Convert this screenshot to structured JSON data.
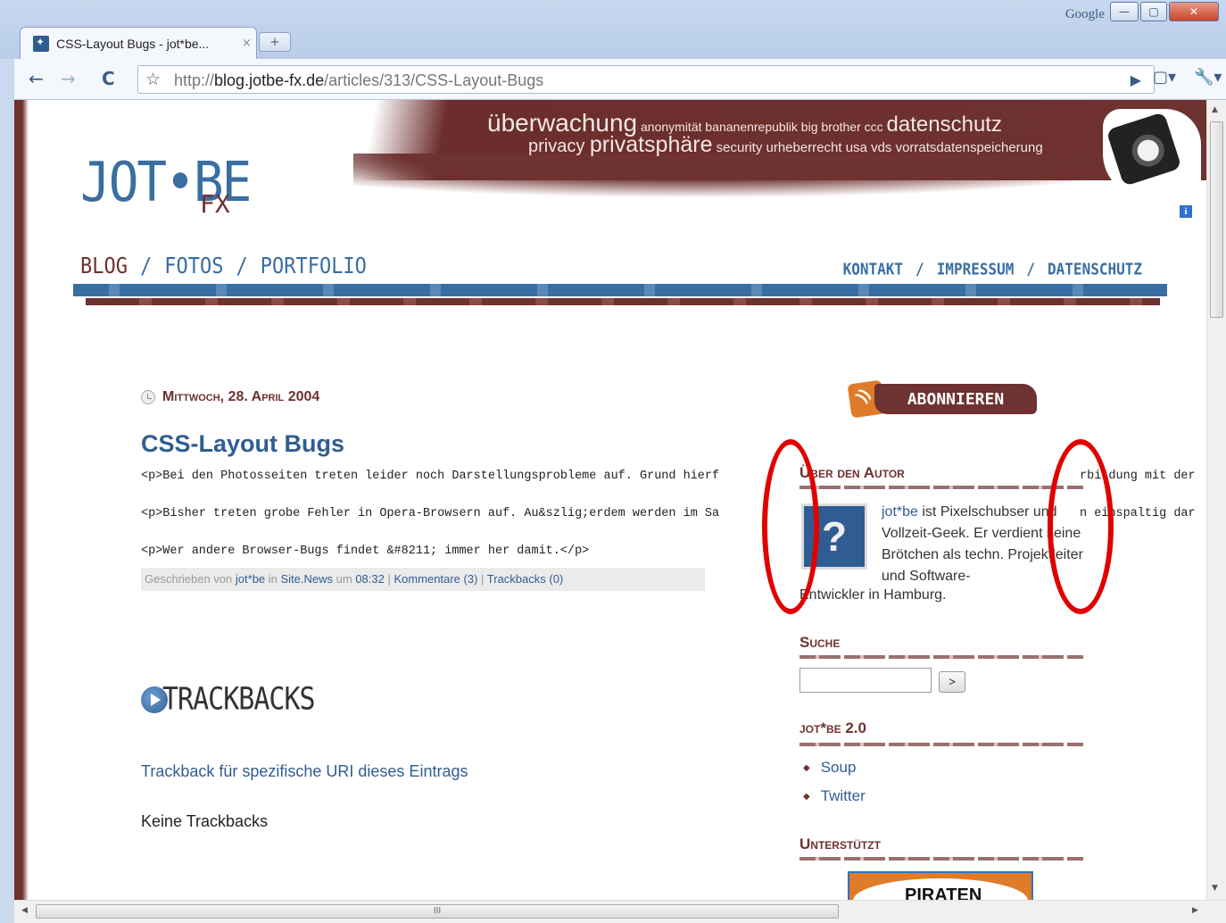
{
  "window": {
    "brand_label": "Google",
    "min_label": "—",
    "max_label": "▢",
    "close_label": "✕"
  },
  "tab": {
    "title": "CSS-Layout Bugs - jot*be...",
    "close": "×",
    "new_tab": "+"
  },
  "toolbar": {
    "back": "←",
    "forward": "→",
    "reload": "C",
    "star": "☆",
    "url_prefix": "http://",
    "url_domain": "blog.jotbe-fx.de",
    "url_path": "/articles/313/CSS-Layout-Bugs",
    "go": "▶",
    "page_menu": "▢▾",
    "wrench_menu": "🔧▾"
  },
  "header": {
    "tags_line1": {
      "w1": "überwachung",
      "w2": " anonymität bananenrepublik big brother ccc ",
      "w3": "datenschutz"
    },
    "tags_line2": {
      "w1": "privacy ",
      "w2": "privatsphäre",
      "w3": " security urheberrecht usa vds vorratsdatenspeicherung"
    },
    "logo": "JOT•BE",
    "logo_sub": "FX",
    "info": "i",
    "nav_left": [
      "BLOG",
      "FOTOS",
      "PORTFOLIO"
    ],
    "nav_right": [
      "KONTAKT",
      "IMPRESSUM",
      "DATENSCHUTZ"
    ],
    "separator": "/"
  },
  "post": {
    "date": "Mittwoch, 28. April 2004",
    "title": "CSS-Layout Bugs",
    "lines": [
      "<p>Bei den Photosseiten treten leider noch Darstellungsprobleme auf. Grund hierf",
      "<p>Bisher treten grobe Fehler in Opera-Browsern auf. Au&szlig;erdem werden im Sa",
      "<p>Wer andere Browser-Bugs findet &#8211; immer her damit.</p>"
    ],
    "line_tails": [
      "rbi dung mit der",
      "n einspaltig dar"
    ],
    "meta": {
      "written_by": "Geschrieben von ",
      "author": "jot*be",
      "in": " in ",
      "category": "Site.News",
      "at": " um ",
      "time": "08:32",
      "sep": " | ",
      "comments": "Kommentare (3)",
      "trackbacks": "Trackbacks (0)"
    }
  },
  "trackbacks": {
    "heading": "TRACKBACKS",
    "link": "Trackback für spezifische URI dieses Eintrags",
    "none": "Keine Trackbacks"
  },
  "sidebar": {
    "subscribe": "ABONNIEREN",
    "about_title": "Über den Autor",
    "avatar_glyph": "?",
    "about_link": "jot*be",
    "about_text": " ist Pixelschubser und Vollzeit-Geek. Er verdient seine Brötchen als techn. Projektleiter und Software-",
    "about_text2": "Entwickler in Hamburg.",
    "search_title": "Suche",
    "search_button": ">",
    "jotbe_title": "jot*be 2.0",
    "links": [
      "Soup",
      "Twitter"
    ],
    "support_title": "Unterstützt",
    "pirate_text": "PIRATEN"
  },
  "scrollbar": {
    "up": "▲",
    "down": "▼",
    "left": "◀",
    "right": "▶",
    "grip": "III"
  },
  "colors": {
    "brand_blue": "#2f5d93",
    "brand_brown": "#6e3230",
    "annotation_red": "#e00000"
  }
}
